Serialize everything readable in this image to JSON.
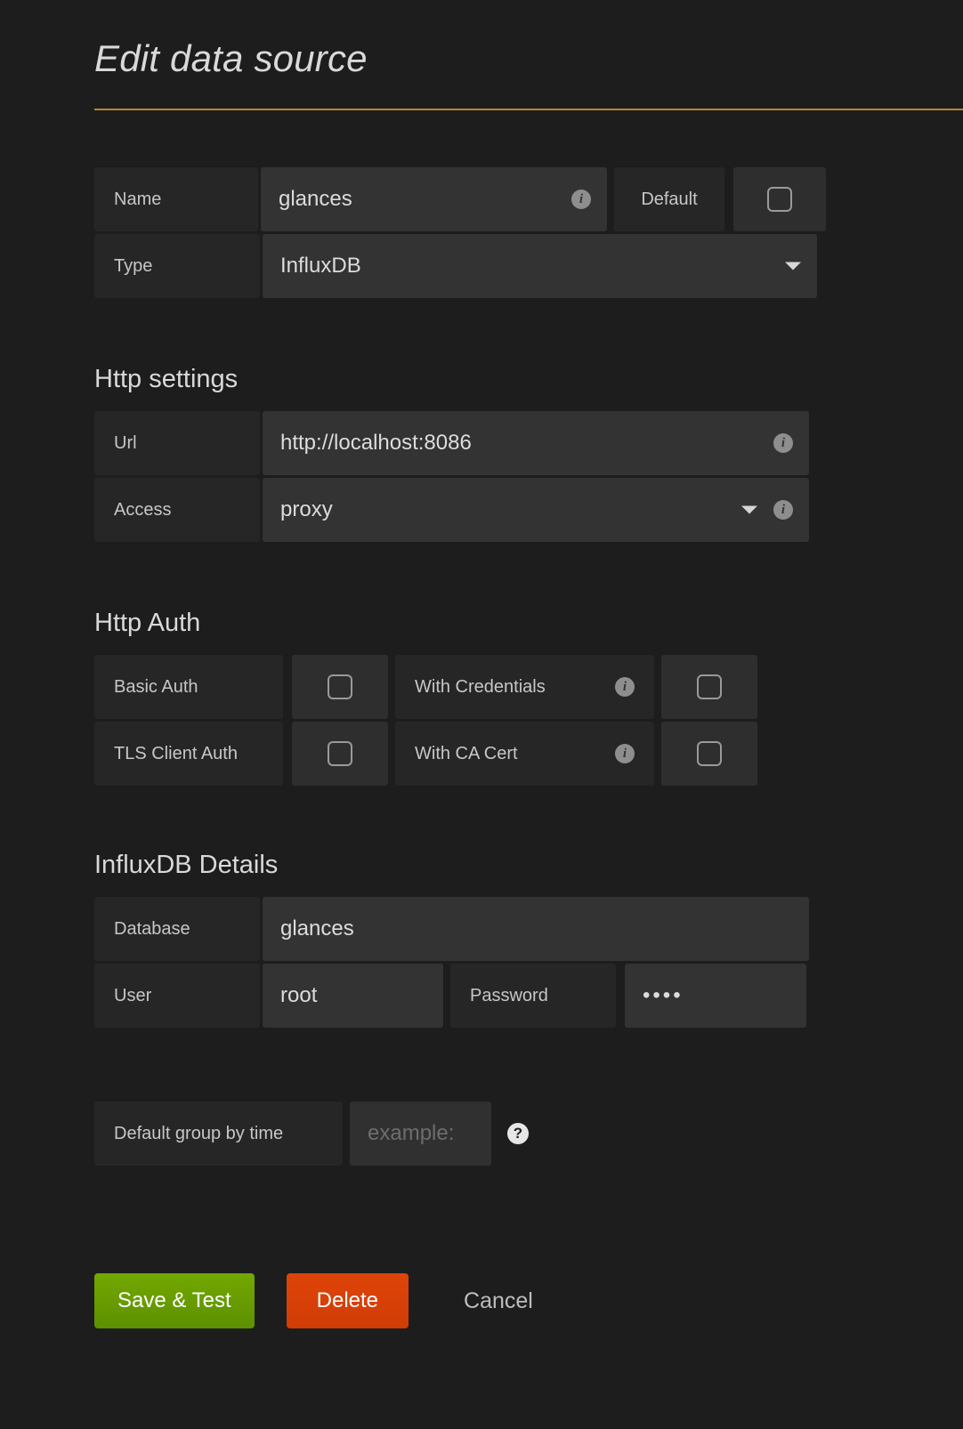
{
  "page": {
    "title": "Edit data source",
    "accent_rule_color": "#b5862a",
    "background_color": "#1d1d1d"
  },
  "basic": {
    "name_label": "Name",
    "name_value": "glances",
    "name_info_icon": "info-icon",
    "default_label": "Default",
    "default_checked": false,
    "type_label": "Type",
    "type_value": "InfluxDB",
    "type_caret_icon": "chevron-down-icon"
  },
  "http_settings": {
    "heading": "Http settings",
    "url_label": "Url",
    "url_value": "http://localhost:8086",
    "url_info_icon": "info-icon",
    "access_label": "Access",
    "access_value": "proxy",
    "access_caret_icon": "chevron-down-icon",
    "access_info_icon": "info-icon"
  },
  "http_auth": {
    "heading": "Http Auth",
    "basic_auth_label": "Basic Auth",
    "basic_auth_checked": false,
    "with_credentials_label": "With Credentials",
    "with_credentials_checked": false,
    "with_credentials_info_icon": "info-icon",
    "tls_client_auth_label": "TLS Client Auth",
    "tls_client_auth_checked": false,
    "with_ca_cert_label": "With CA Cert",
    "with_ca_cert_checked": false,
    "with_ca_cert_info_icon": "info-icon"
  },
  "influxdb_details": {
    "heading": "InfluxDB Details",
    "database_label": "Database",
    "database_value": "glances",
    "user_label": "User",
    "user_value": "root",
    "password_label": "Password",
    "password_value": "••••"
  },
  "group_by": {
    "label": "Default group by time",
    "placeholder": "example:",
    "value": "",
    "help_icon": "question-mark-icon"
  },
  "actions": {
    "save_label": "Save & Test",
    "save_color": "#6ca400",
    "delete_label": "Delete",
    "delete_color": "#d9400b",
    "cancel_label": "Cancel"
  }
}
